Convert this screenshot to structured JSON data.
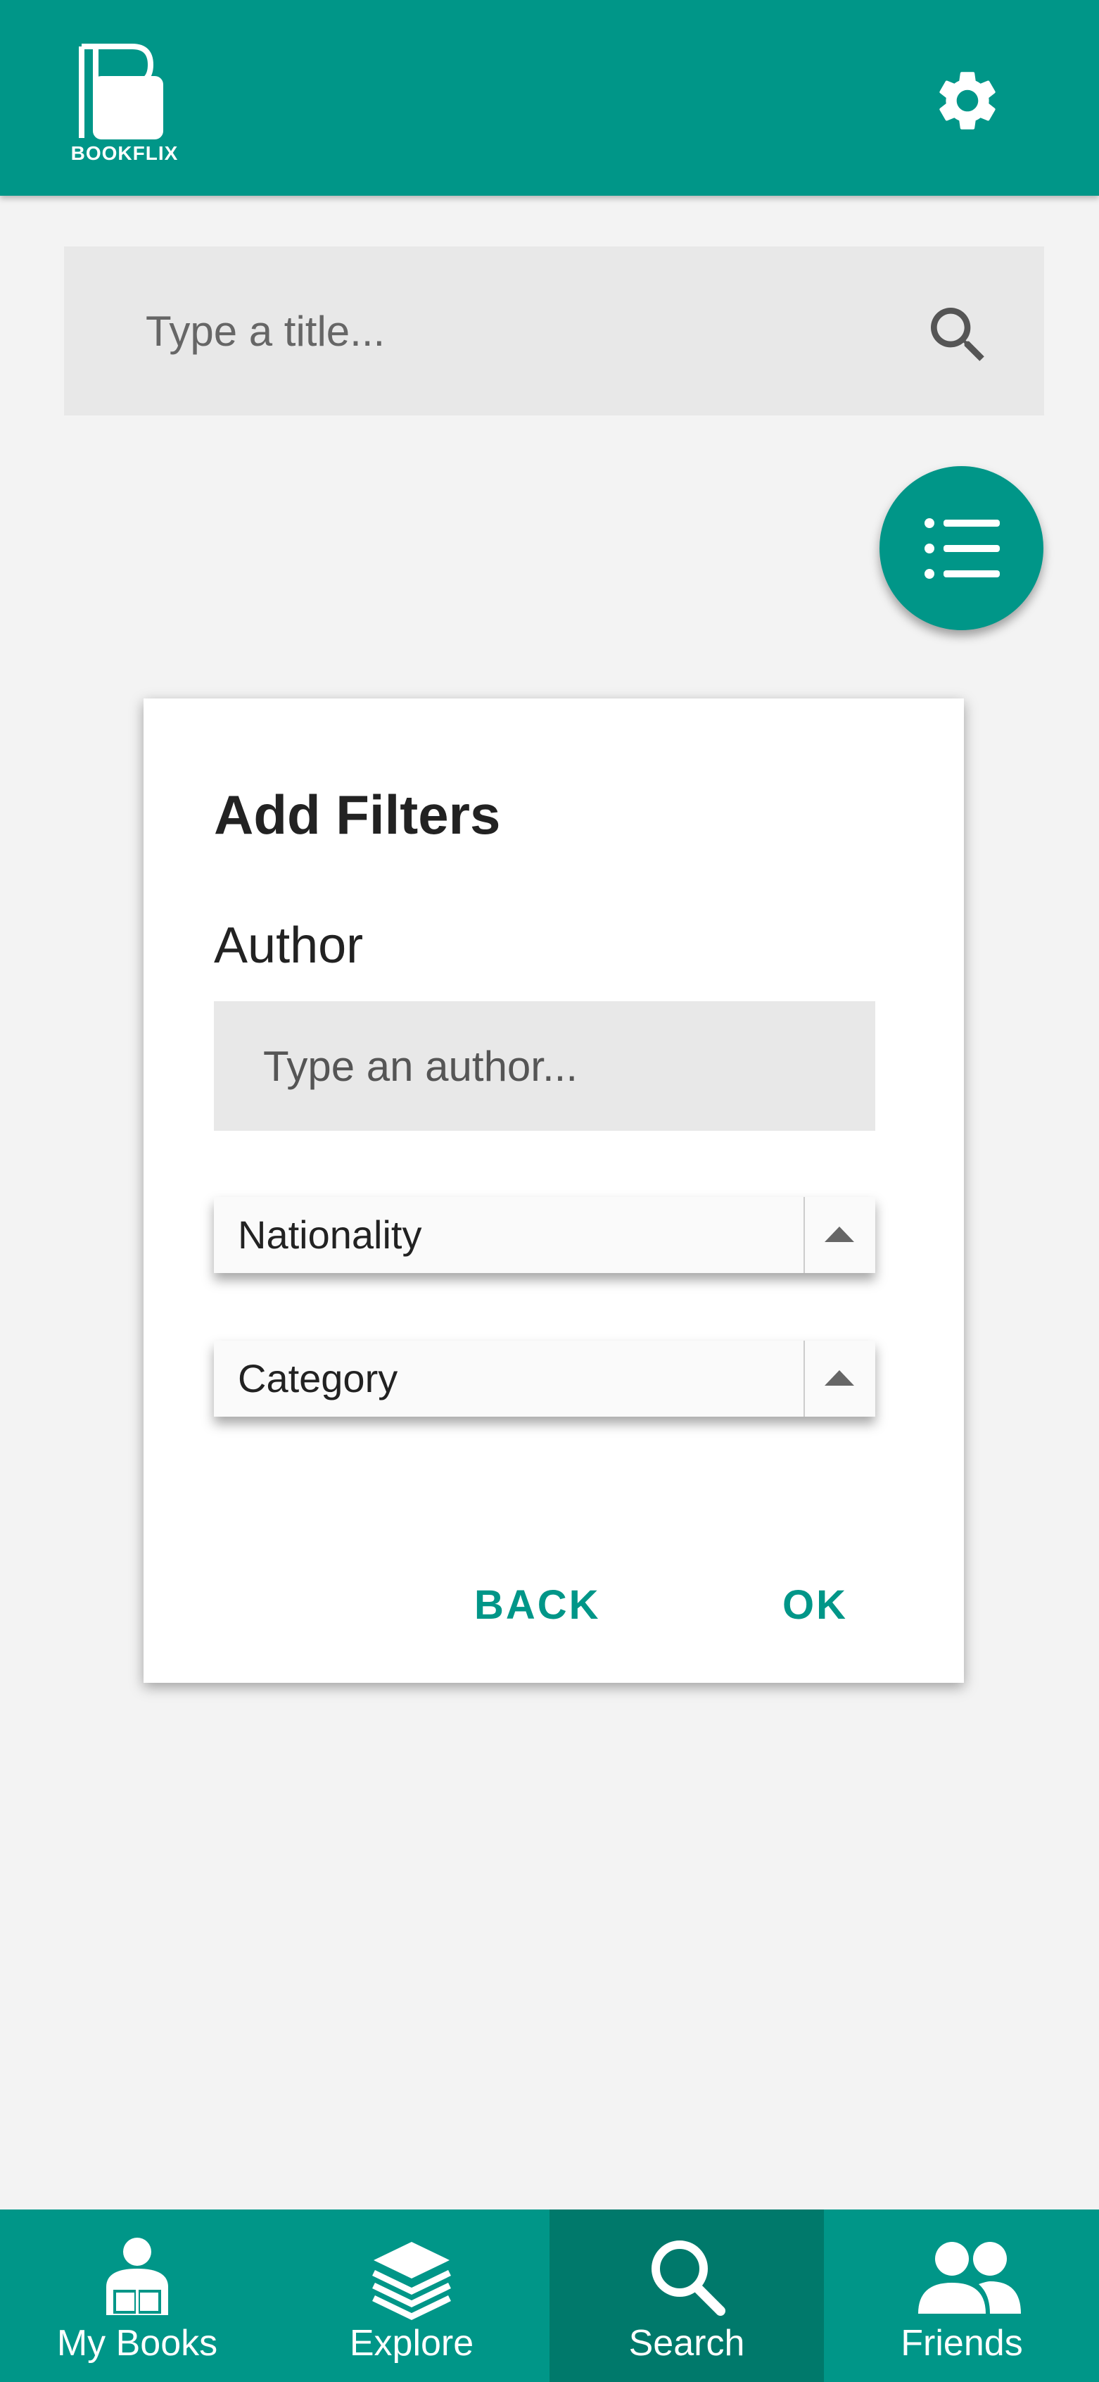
{
  "appbar": {
    "logo_text": "BOOKFLIX",
    "settings_icon": "gear-icon",
    "background": "#009688"
  },
  "search": {
    "placeholder": "Type a title...",
    "icon": "search-icon"
  },
  "fab": {
    "icon": "filter-list-icon"
  },
  "dialog": {
    "title": "Add Filters",
    "author_label": "Author",
    "author_placeholder": "Type an author...",
    "nationality_label": "Nationality",
    "category_label": "Category",
    "back_label": "BACK",
    "ok_label": "OK"
  },
  "bottom_nav": {
    "items": [
      {
        "label": "My Books",
        "icon": "reader-icon"
      },
      {
        "label": "Explore",
        "icon": "books-stack-icon"
      },
      {
        "label": "Search",
        "icon": "search-icon"
      },
      {
        "label": "Friends",
        "icon": "people-icon"
      }
    ],
    "active": "Search"
  },
  "colors": {
    "primary": "#009688",
    "primary_dark": "#00796b",
    "background": "#f3f3f3"
  }
}
